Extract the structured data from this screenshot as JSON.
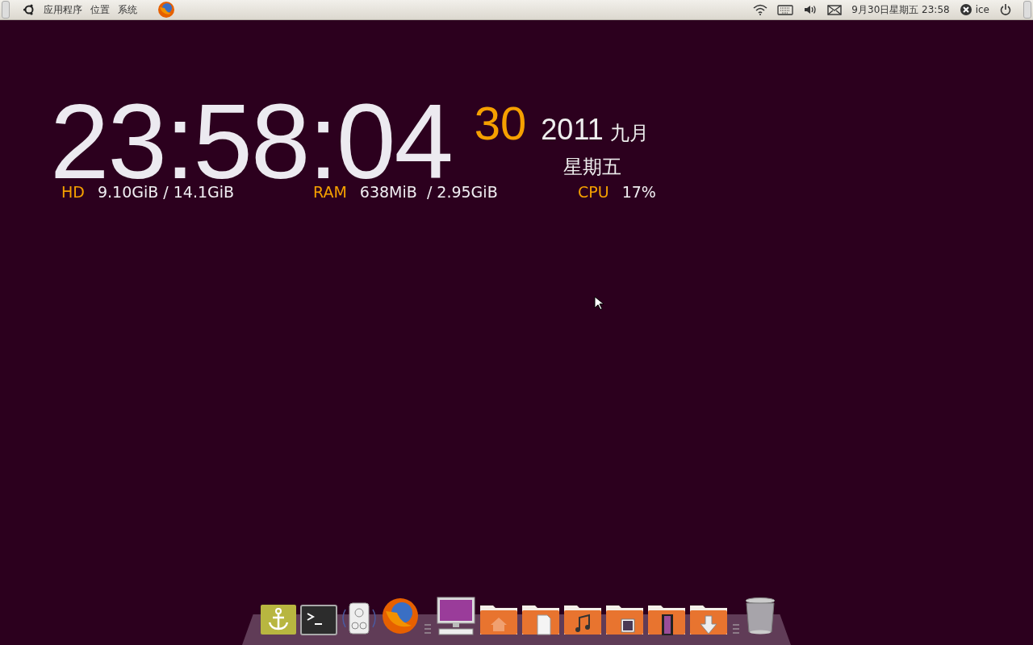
{
  "top_panel": {
    "menus": [
      "应用程序",
      "位置",
      "系统"
    ],
    "clock": "9月30日星期五 23:58",
    "user": "ice"
  },
  "clock_widget": {
    "time": "23:58:04",
    "day": "30",
    "year": "2011",
    "month": "九月",
    "weekday": "星期五",
    "stats": [
      {
        "label": "HD",
        "value": "9.10GiB / 14.1GiB"
      },
      {
        "label": "RAM",
        "value": "638MiB  / 2.95GiB"
      },
      {
        "label": "CPU",
        "value": "17%"
      }
    ]
  },
  "dock": [
    {
      "kind": "anchor"
    },
    {
      "kind": "terminal"
    },
    {
      "kind": "speaker"
    },
    {
      "kind": "firefox"
    },
    {
      "kind": "separator"
    },
    {
      "kind": "monitor"
    },
    {
      "kind": "home"
    },
    {
      "kind": "documents"
    },
    {
      "kind": "music"
    },
    {
      "kind": "pictures"
    },
    {
      "kind": "videos"
    },
    {
      "kind": "downloads"
    },
    {
      "kind": "separator"
    },
    {
      "kind": "trash"
    }
  ]
}
